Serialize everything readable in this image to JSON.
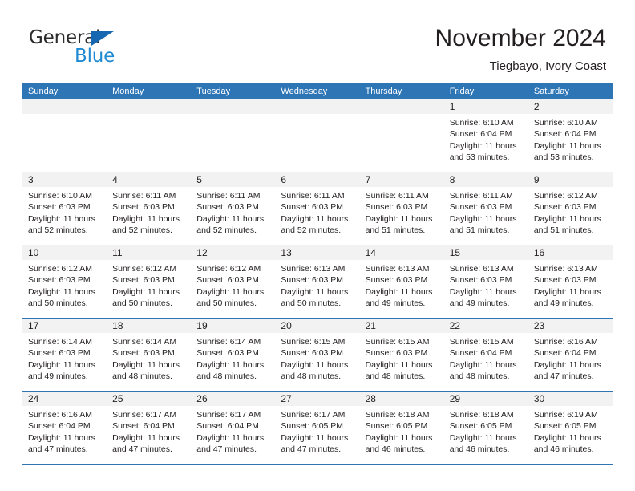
{
  "brand": {
    "name_part1": "General",
    "name_part2": "Blue",
    "triangle_color": "#1667b2",
    "blue_color": "#1f8ad2"
  },
  "header": {
    "title": "November 2024",
    "subtitle": "Tiegbayo, Ivory Coast"
  },
  "theme": {
    "header_blue": "#2e75b6",
    "daynum_gray": "#f2f2f2",
    "text": "#231f20"
  },
  "weekdays": [
    "Sunday",
    "Monday",
    "Tuesday",
    "Wednesday",
    "Thursday",
    "Friday",
    "Saturday"
  ],
  "weeks": [
    [
      {
        "day": "",
        "empty": true
      },
      {
        "day": "",
        "empty": true
      },
      {
        "day": "",
        "empty": true
      },
      {
        "day": "",
        "empty": true
      },
      {
        "day": "",
        "empty": true
      },
      {
        "day": "1",
        "sunrise": "Sunrise: 6:10 AM",
        "sunset": "Sunset: 6:04 PM",
        "daylight": "Daylight: 11 hours and 53 minutes."
      },
      {
        "day": "2",
        "sunrise": "Sunrise: 6:10 AM",
        "sunset": "Sunset: 6:04 PM",
        "daylight": "Daylight: 11 hours and 53 minutes."
      }
    ],
    [
      {
        "day": "3",
        "sunrise": "Sunrise: 6:10 AM",
        "sunset": "Sunset: 6:03 PM",
        "daylight": "Daylight: 11 hours and 52 minutes."
      },
      {
        "day": "4",
        "sunrise": "Sunrise: 6:11 AM",
        "sunset": "Sunset: 6:03 PM",
        "daylight": "Daylight: 11 hours and 52 minutes."
      },
      {
        "day": "5",
        "sunrise": "Sunrise: 6:11 AM",
        "sunset": "Sunset: 6:03 PM",
        "daylight": "Daylight: 11 hours and 52 minutes."
      },
      {
        "day": "6",
        "sunrise": "Sunrise: 6:11 AM",
        "sunset": "Sunset: 6:03 PM",
        "daylight": "Daylight: 11 hours and 52 minutes."
      },
      {
        "day": "7",
        "sunrise": "Sunrise: 6:11 AM",
        "sunset": "Sunset: 6:03 PM",
        "daylight": "Daylight: 11 hours and 51 minutes."
      },
      {
        "day": "8",
        "sunrise": "Sunrise: 6:11 AM",
        "sunset": "Sunset: 6:03 PM",
        "daylight": "Daylight: 11 hours and 51 minutes."
      },
      {
        "day": "9",
        "sunrise": "Sunrise: 6:12 AM",
        "sunset": "Sunset: 6:03 PM",
        "daylight": "Daylight: 11 hours and 51 minutes."
      }
    ],
    [
      {
        "day": "10",
        "sunrise": "Sunrise: 6:12 AM",
        "sunset": "Sunset: 6:03 PM",
        "daylight": "Daylight: 11 hours and 50 minutes."
      },
      {
        "day": "11",
        "sunrise": "Sunrise: 6:12 AM",
        "sunset": "Sunset: 6:03 PM",
        "daylight": "Daylight: 11 hours and 50 minutes."
      },
      {
        "day": "12",
        "sunrise": "Sunrise: 6:12 AM",
        "sunset": "Sunset: 6:03 PM",
        "daylight": "Daylight: 11 hours and 50 minutes."
      },
      {
        "day": "13",
        "sunrise": "Sunrise: 6:13 AM",
        "sunset": "Sunset: 6:03 PM",
        "daylight": "Daylight: 11 hours and 50 minutes."
      },
      {
        "day": "14",
        "sunrise": "Sunrise: 6:13 AM",
        "sunset": "Sunset: 6:03 PM",
        "daylight": "Daylight: 11 hours and 49 minutes."
      },
      {
        "day": "15",
        "sunrise": "Sunrise: 6:13 AM",
        "sunset": "Sunset: 6:03 PM",
        "daylight": "Daylight: 11 hours and 49 minutes."
      },
      {
        "day": "16",
        "sunrise": "Sunrise: 6:13 AM",
        "sunset": "Sunset: 6:03 PM",
        "daylight": "Daylight: 11 hours and 49 minutes."
      }
    ],
    [
      {
        "day": "17",
        "sunrise": "Sunrise: 6:14 AM",
        "sunset": "Sunset: 6:03 PM",
        "daylight": "Daylight: 11 hours and 49 minutes."
      },
      {
        "day": "18",
        "sunrise": "Sunrise: 6:14 AM",
        "sunset": "Sunset: 6:03 PM",
        "daylight": "Daylight: 11 hours and 48 minutes."
      },
      {
        "day": "19",
        "sunrise": "Sunrise: 6:14 AM",
        "sunset": "Sunset: 6:03 PM",
        "daylight": "Daylight: 11 hours and 48 minutes."
      },
      {
        "day": "20",
        "sunrise": "Sunrise: 6:15 AM",
        "sunset": "Sunset: 6:03 PM",
        "daylight": "Daylight: 11 hours and 48 minutes."
      },
      {
        "day": "21",
        "sunrise": "Sunrise: 6:15 AM",
        "sunset": "Sunset: 6:03 PM",
        "daylight": "Daylight: 11 hours and 48 minutes."
      },
      {
        "day": "22",
        "sunrise": "Sunrise: 6:15 AM",
        "sunset": "Sunset: 6:04 PM",
        "daylight": "Daylight: 11 hours and 48 minutes."
      },
      {
        "day": "23",
        "sunrise": "Sunrise: 6:16 AM",
        "sunset": "Sunset: 6:04 PM",
        "daylight": "Daylight: 11 hours and 47 minutes."
      }
    ],
    [
      {
        "day": "24",
        "sunrise": "Sunrise: 6:16 AM",
        "sunset": "Sunset: 6:04 PM",
        "daylight": "Daylight: 11 hours and 47 minutes."
      },
      {
        "day": "25",
        "sunrise": "Sunrise: 6:17 AM",
        "sunset": "Sunset: 6:04 PM",
        "daylight": "Daylight: 11 hours and 47 minutes."
      },
      {
        "day": "26",
        "sunrise": "Sunrise: 6:17 AM",
        "sunset": "Sunset: 6:04 PM",
        "daylight": "Daylight: 11 hours and 47 minutes."
      },
      {
        "day": "27",
        "sunrise": "Sunrise: 6:17 AM",
        "sunset": "Sunset: 6:05 PM",
        "daylight": "Daylight: 11 hours and 47 minutes."
      },
      {
        "day": "28",
        "sunrise": "Sunrise: 6:18 AM",
        "sunset": "Sunset: 6:05 PM",
        "daylight": "Daylight: 11 hours and 46 minutes."
      },
      {
        "day": "29",
        "sunrise": "Sunrise: 6:18 AM",
        "sunset": "Sunset: 6:05 PM",
        "daylight": "Daylight: 11 hours and 46 minutes."
      },
      {
        "day": "30",
        "sunrise": "Sunrise: 6:19 AM",
        "sunset": "Sunset: 6:05 PM",
        "daylight": "Daylight: 11 hours and 46 minutes."
      }
    ]
  ]
}
